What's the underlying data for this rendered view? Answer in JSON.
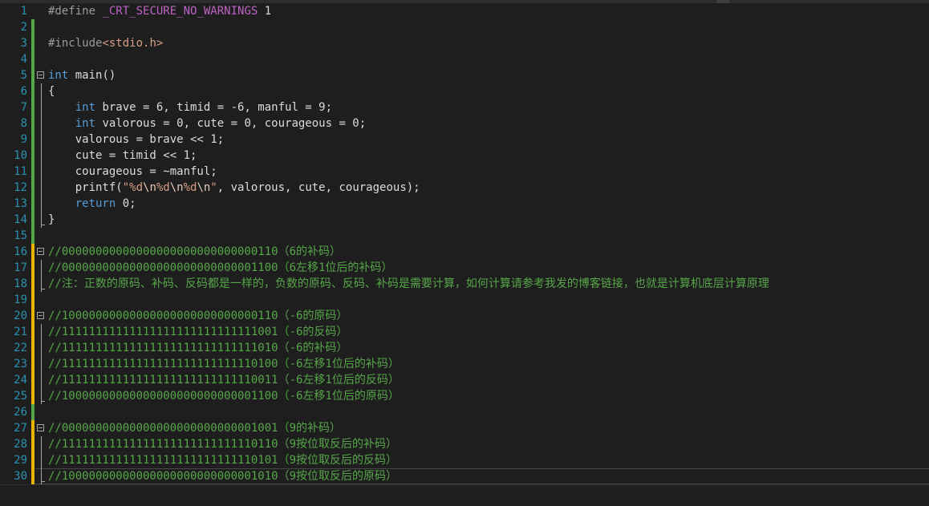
{
  "editor": {
    "lines": [
      {
        "num": "1",
        "bar": "none",
        "segments": [
          [
            "pp",
            "#define "
          ],
          [
            "macro",
            "_CRT_SECURE_NO_WARNINGS"
          ],
          [
            "plain",
            " 1"
          ]
        ]
      },
      {
        "num": "2",
        "bar": "green",
        "segments": []
      },
      {
        "num": "3",
        "bar": "green",
        "segments": [
          [
            "pp",
            "#include"
          ],
          [
            "str",
            "<stdio.h>"
          ]
        ]
      },
      {
        "num": "4",
        "bar": "green",
        "segments": []
      },
      {
        "num": "5",
        "bar": "green",
        "fold": "box",
        "segments": [
          [
            "kw",
            "int"
          ],
          [
            "plain",
            " main()"
          ]
        ]
      },
      {
        "num": "6",
        "bar": "green",
        "fold": "guide",
        "segments": [
          [
            "plain",
            "{"
          ]
        ]
      },
      {
        "num": "7",
        "bar": "green",
        "fold": "guide",
        "segments": [
          [
            "plain",
            "    "
          ],
          [
            "kw",
            "int"
          ],
          [
            "plain",
            " brave = 6, timid = -6, manful = 9;"
          ]
        ]
      },
      {
        "num": "8",
        "bar": "green",
        "fold": "guide",
        "segments": [
          [
            "plain",
            "    "
          ],
          [
            "kw",
            "int"
          ],
          [
            "plain",
            " valorous = 0, cute = 0, courageous = 0;"
          ]
        ]
      },
      {
        "num": "9",
        "bar": "green",
        "fold": "guide",
        "segments": [
          [
            "plain",
            "    valorous = brave << 1;"
          ]
        ]
      },
      {
        "num": "10",
        "bar": "green",
        "fold": "guide",
        "segments": [
          [
            "plain",
            "    cute = timid << 1;"
          ]
        ]
      },
      {
        "num": "11",
        "bar": "green",
        "fold": "guide",
        "segments": [
          [
            "plain",
            "    courageous = ~manful;"
          ]
        ]
      },
      {
        "num": "12",
        "bar": "green",
        "fold": "guide",
        "segments": [
          [
            "plain",
            "    printf("
          ],
          [
            "str",
            "\"%d"
          ],
          [
            "esc",
            "\\n"
          ],
          [
            "str",
            "%d"
          ],
          [
            "esc",
            "\\n"
          ],
          [
            "str",
            "%d"
          ],
          [
            "esc",
            "\\n"
          ],
          [
            "str",
            "\""
          ],
          [
            "plain",
            ", valorous, cute, courageous);"
          ]
        ]
      },
      {
        "num": "13",
        "bar": "green",
        "fold": "guide",
        "segments": [
          [
            "plain",
            "    "
          ],
          [
            "kw",
            "return"
          ],
          [
            "plain",
            " 0;"
          ]
        ]
      },
      {
        "num": "14",
        "bar": "green",
        "fold": "guide-end",
        "segments": [
          [
            "plain",
            "}"
          ]
        ]
      },
      {
        "num": "15",
        "bar": "green",
        "segments": []
      },
      {
        "num": "16",
        "bar": "yellow",
        "fold": "box",
        "segments": [
          [
            "cm",
            "//00000000000000000000000000000110（6的补码）"
          ]
        ]
      },
      {
        "num": "17",
        "bar": "yellow",
        "fold": "guide",
        "segments": [
          [
            "cm",
            "//00000000000000000000000000001100（6左移1位后的补码）"
          ]
        ]
      },
      {
        "num": "18",
        "bar": "yellow",
        "fold": "guide-end",
        "segments": [
          [
            "cm",
            "//注：正数的原码、补码、反码都是一样的，负数的原码、反码、补码是需要计算，如何计算请参考我发的博客链接，也就是计算机底层计算原理"
          ]
        ]
      },
      {
        "num": "19",
        "bar": "yellow",
        "segments": []
      },
      {
        "num": "20",
        "bar": "yellow",
        "fold": "box",
        "segments": [
          [
            "cm",
            "//10000000000000000000000000000110（-6的原码）"
          ]
        ]
      },
      {
        "num": "21",
        "bar": "yellow",
        "fold": "guide",
        "segments": [
          [
            "cm",
            "//11111111111111111111111111111001（-6的反码）"
          ]
        ]
      },
      {
        "num": "22",
        "bar": "yellow",
        "fold": "guide",
        "segments": [
          [
            "cm",
            "//11111111111111111111111111111010（-6的补码）"
          ]
        ]
      },
      {
        "num": "23",
        "bar": "yellow",
        "fold": "guide",
        "segments": [
          [
            "cm",
            "//11111111111111111111111111110100（-6左移1位后的补码）"
          ]
        ]
      },
      {
        "num": "24",
        "bar": "yellow",
        "fold": "guide",
        "segments": [
          [
            "cm",
            "//11111111111111111111111111110011（-6左移1位后的反码）"
          ]
        ]
      },
      {
        "num": "25",
        "bar": "yellow",
        "fold": "guide-end",
        "segments": [
          [
            "cm",
            "//10000000000000000000000000001100（-6左移1位后的原码）"
          ]
        ]
      },
      {
        "num": "26",
        "bar": "green",
        "segments": []
      },
      {
        "num": "27",
        "bar": "yellow",
        "fold": "box",
        "segments": [
          [
            "cm",
            "//00000000000000000000000000001001（9的补码）"
          ]
        ]
      },
      {
        "num": "28",
        "bar": "yellow",
        "fold": "guide",
        "segments": [
          [
            "cm",
            "//11111111111111111111111111110110（9按位取反后的补码）"
          ]
        ]
      },
      {
        "num": "29",
        "bar": "yellow",
        "fold": "guide",
        "segments": [
          [
            "cm",
            "//11111111111111111111111111110101（9按位取反后的反码）"
          ]
        ]
      },
      {
        "num": "30",
        "bar": "yellow",
        "fold": "guide-end",
        "current": true,
        "segments": [
          [
            "cm",
            "//10000000000000000000000000001010（9按位取反后的原码）"
          ]
        ]
      }
    ]
  }
}
